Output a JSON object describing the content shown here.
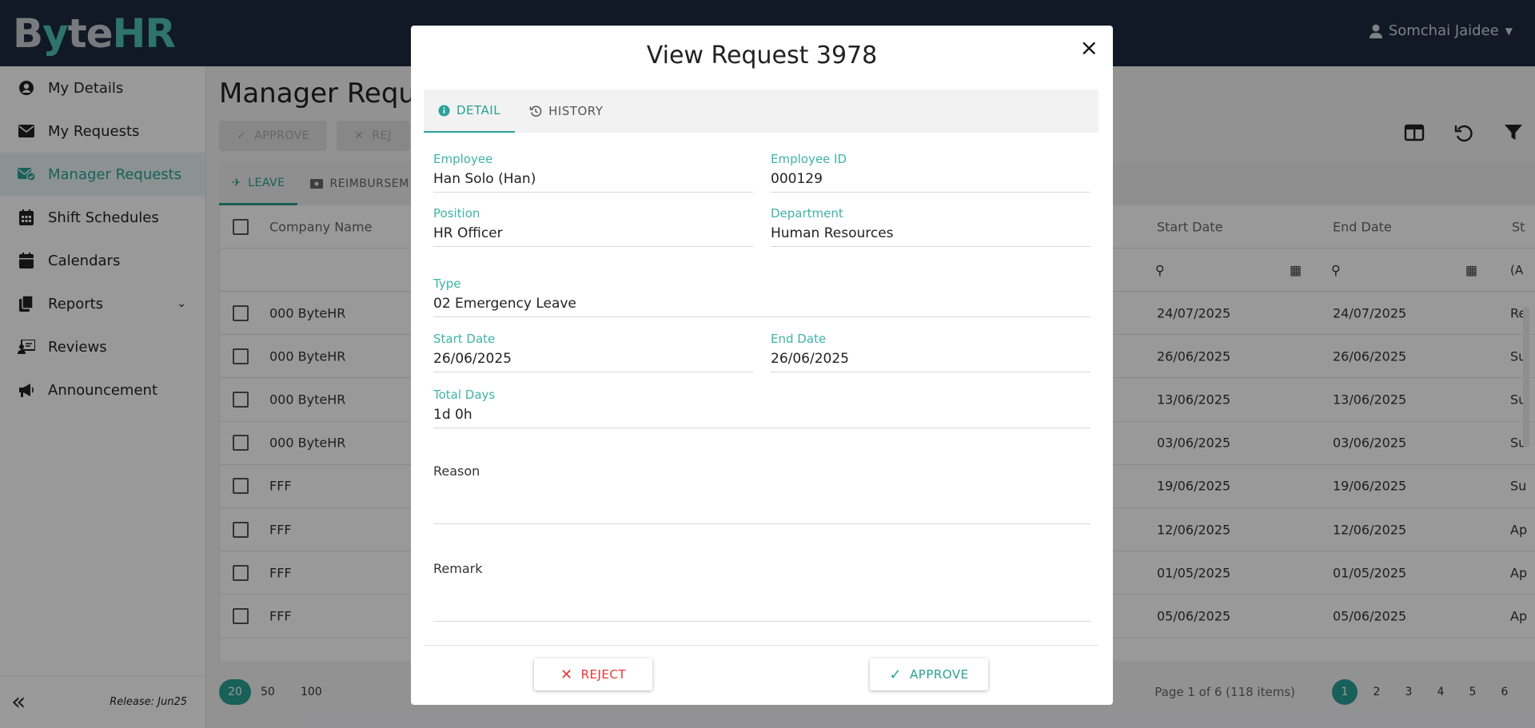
{
  "app": {
    "logo_dark": "B",
    "logo_y": "y",
    "logo_te": "te",
    "logo_hr": "HR",
    "user_name": "Somchai Jaidee"
  },
  "sidebar": {
    "items": [
      {
        "label": "My Details",
        "icon": "user-circle-icon"
      },
      {
        "label": "My Requests",
        "icon": "envelope-icon"
      },
      {
        "label": "Manager Requests",
        "icon": "envelope-check-icon"
      },
      {
        "label": "Shift Schedules",
        "icon": "calendar-grid-icon"
      },
      {
        "label": "Calendars",
        "icon": "calendar-icon"
      },
      {
        "label": "Reports",
        "icon": "copy-icon"
      },
      {
        "label": "Reviews",
        "icon": "review-icon"
      },
      {
        "label": "Announcement",
        "icon": "megaphone-icon"
      }
    ],
    "release": "Release: Jun25"
  },
  "main": {
    "title": "Manager Reque",
    "approve_label": "APPROVE",
    "reject_label": "REJ",
    "tabs": [
      {
        "label": "LEAVE"
      },
      {
        "label": "REIMBURSEM"
      }
    ],
    "columns": {
      "company": "Company Name",
      "start": "Start Date",
      "end": "End Date",
      "status": "St"
    },
    "filter_status": "(A",
    "rows": [
      {
        "company": "000 ByteHR",
        "start": "24/07/2025",
        "end": "24/07/2025",
        "status": "Re"
      },
      {
        "company": "000 ByteHR",
        "start": "26/06/2025",
        "end": "26/06/2025",
        "status": "Su"
      },
      {
        "company": "000 ByteHR",
        "start": "13/06/2025",
        "end": "13/06/2025",
        "status": "Su"
      },
      {
        "company": "000 ByteHR",
        "start": "03/06/2025",
        "end": "03/06/2025",
        "status": "Su"
      },
      {
        "company": "FFF",
        "start": "19/06/2025",
        "end": "19/06/2025",
        "status": "Su"
      },
      {
        "company": "FFF",
        "start": "12/06/2025",
        "end": "12/06/2025",
        "status": "Ap"
      },
      {
        "company": "FFF",
        "start": "01/05/2025",
        "end": "01/05/2025",
        "status": "Ap"
      },
      {
        "company": "FFF",
        "start": "05/06/2025",
        "end": "05/06/2025",
        "status": "Ap"
      }
    ],
    "page_sizes": [
      "20",
      "50",
      "100"
    ],
    "page_info": "Page 1 of 6 (118 items)",
    "pages": [
      "1",
      "2",
      "3",
      "4",
      "5",
      "6"
    ]
  },
  "modal": {
    "title": "View Request 3978",
    "close": "×",
    "tabs": [
      {
        "label": "DETAIL"
      },
      {
        "label": "HISTORY"
      }
    ],
    "fields": {
      "employee_label": "Employee",
      "employee": "Han Solo (Han)",
      "employee_id_label": "Employee ID",
      "employee_id": "000129",
      "position_label": "Position",
      "position": "HR Officer",
      "department_label": "Department",
      "department": "Human Resources",
      "type_label": "Type",
      "type": "02 Emergency Leave",
      "start_label": "Start Date",
      "start": "26/06/2025",
      "end_label": "End Date",
      "end": "26/06/2025",
      "total_label": "Total Days",
      "total": "1d 0h",
      "reason_placeholder": "Reason",
      "remark_placeholder": "Remark"
    },
    "reject_label": "REJECT",
    "approve_label": "APPROVE"
  },
  "colors": {
    "accent": "#2aa195",
    "topbar": "#1b2a3f",
    "reject": "#e53935"
  }
}
